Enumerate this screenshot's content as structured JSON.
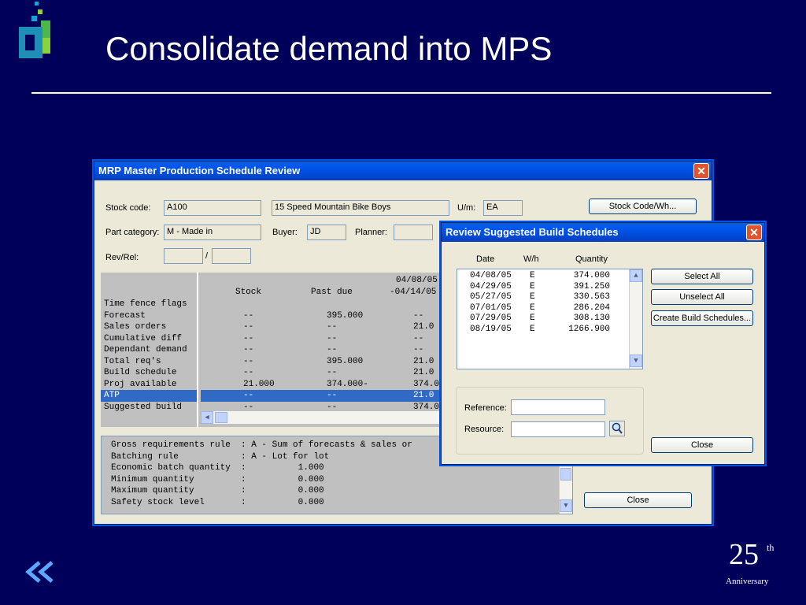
{
  "slide": {
    "title": "Consolidate demand into MPS",
    "anniversary_number": "25",
    "anniversary_suffix": "th",
    "anniversary_label": "Anniversary"
  },
  "main_window": {
    "title": "MRP Master Production Schedule Review",
    "stock_code_label": "Stock code:",
    "stock_code": "A100",
    "description": "15 Speed Mountain Bike Boys",
    "uom_label": "U/m:",
    "uom": "EA",
    "stock_code_button": "Stock Code/Wh...",
    "part_category_label": "Part category:",
    "part_category": "M - Made in",
    "buyer_label": "Buyer:",
    "buyer": "JD",
    "planner_label": "Planner:",
    "planner": "",
    "rev_rel_label": "Rev/Rel:",
    "rev": "",
    "rev_sep": "/",
    "rel": "",
    "close_button": "Close",
    "row_labels": [
      "Time fence flags",
      "Forecast",
      "Sales orders",
      "Cumulative diff",
      "Dependant demand",
      "Total req's",
      "Build schedule",
      "Proj available",
      "ATP",
      "Suggested build"
    ],
    "columns": {
      "stock": "Stock",
      "past_due": "Past due",
      "period_line1": "04/08/05",
      "period_line2": "-04/14/05"
    },
    "rows": [
      {
        "stock": "",
        "past_due": "",
        "period": ""
      },
      {
        "stock": "--",
        "past_due": "395.000",
        "period": "--"
      },
      {
        "stock": "--",
        "past_due": "--",
        "period": "21.0"
      },
      {
        "stock": "--",
        "past_due": "--",
        "period": "--"
      },
      {
        "stock": "--",
        "past_due": "--",
        "period": "--"
      },
      {
        "stock": "--",
        "past_due": "395.000",
        "period": "21.0"
      },
      {
        "stock": "--",
        "past_due": "--",
        "period": "21.0"
      },
      {
        "stock": "21.000",
        "past_due": "374.000-",
        "period": "374.0"
      },
      {
        "stock": "--",
        "past_due": "--",
        "period": "21.0"
      },
      {
        "stock": "--",
        "past_due": "--",
        "period": "374.0"
      }
    ],
    "info_lines": [
      "Gross requirements rule  : A - Sum of forecasts & sales or",
      "Batching rule            : A - Lot for lot",
      "Economic batch quantity  :          1.000",
      "Minimum quantity         :          0.000",
      "Maximum quantity         :          0.000",
      "Safety stock level       :          0.000"
    ]
  },
  "dialog": {
    "title": "Review Suggested Build Schedules",
    "headers": [
      "Date",
      "W/h",
      "Quantity"
    ],
    "rows": [
      {
        "date": "04/08/05",
        "wh": "E",
        "qty": "374.000"
      },
      {
        "date": "04/29/05",
        "wh": "E",
        "qty": "391.250"
      },
      {
        "date": "05/27/05",
        "wh": "E",
        "qty": "330.563"
      },
      {
        "date": "07/01/05",
        "wh": "E",
        "qty": "286.204"
      },
      {
        "date": "07/29/05",
        "wh": "E",
        "qty": "308.130"
      },
      {
        "date": "08/19/05",
        "wh": "E",
        "qty": "1266.900"
      }
    ],
    "select_all": "Select All",
    "unselect_all": "Unselect All",
    "create_button": "Create Build Schedules...",
    "reference_label": "Reference:",
    "reference": "",
    "resource_label": "Resource:",
    "resource": "",
    "close_button": "Close"
  },
  "colors": {
    "slide_bg": "#00005b",
    "titlebar": "#0054e3",
    "selection": "#316ac5",
    "close_x": "#e0542c"
  }
}
